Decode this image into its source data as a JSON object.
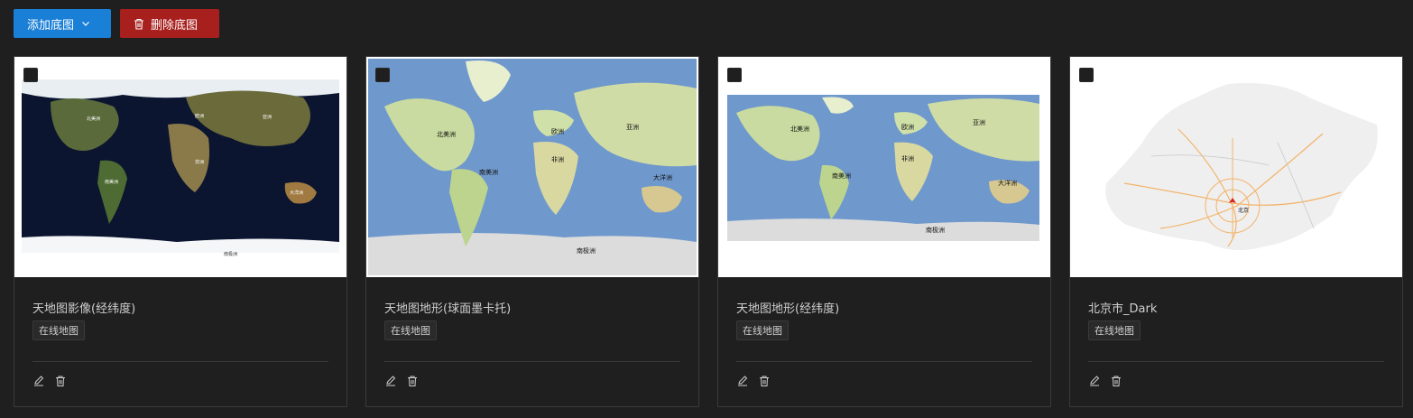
{
  "toolbar": {
    "add_label": "添加底图",
    "delete_label": "删除底图"
  },
  "cards": [
    {
      "title": "天地图影像(经纬度)",
      "tag": "在线地图"
    },
    {
      "title": "天地图地形(球面墨卡托)",
      "tag": "在线地图"
    },
    {
      "title": "天地图地形(经纬度)",
      "tag": "在线地图"
    },
    {
      "title": "北京市_Dark",
      "tag": "在线地图"
    }
  ],
  "map_labels": {
    "north_america": "北美洲",
    "south_america": "南美洲",
    "europe": "欧洲",
    "africa": "非洲",
    "asia": "亚洲",
    "oceania": "大洋洲",
    "antarctica": "南极洲",
    "beijing": "北京"
  },
  "colors": {
    "add_button": "#1a7fd6",
    "delete_button": "#a8201e",
    "background": "#1f1f1f"
  }
}
